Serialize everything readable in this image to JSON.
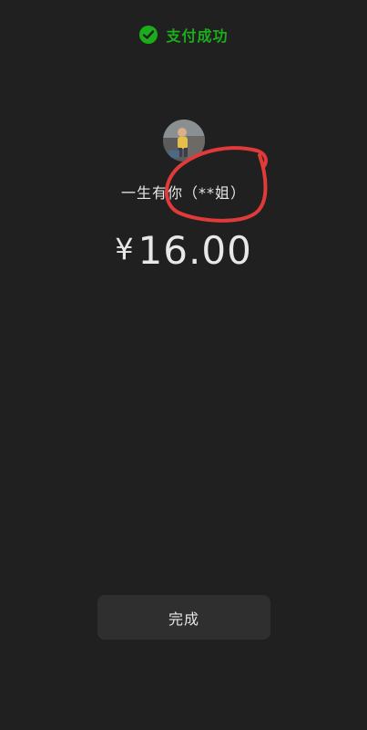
{
  "header": {
    "status_text": "支付成功",
    "status_color": "#1aad19",
    "icon": "wechat-pay-icon"
  },
  "payee": {
    "name": "一生有你（**姐）",
    "avatar": "avatar-photo"
  },
  "payment": {
    "currency_symbol": "¥",
    "amount": "16.00"
  },
  "actions": {
    "done_label": "完成"
  },
  "annotation": {
    "shape": "hand-drawn-circle",
    "color": "#e03a3a"
  }
}
